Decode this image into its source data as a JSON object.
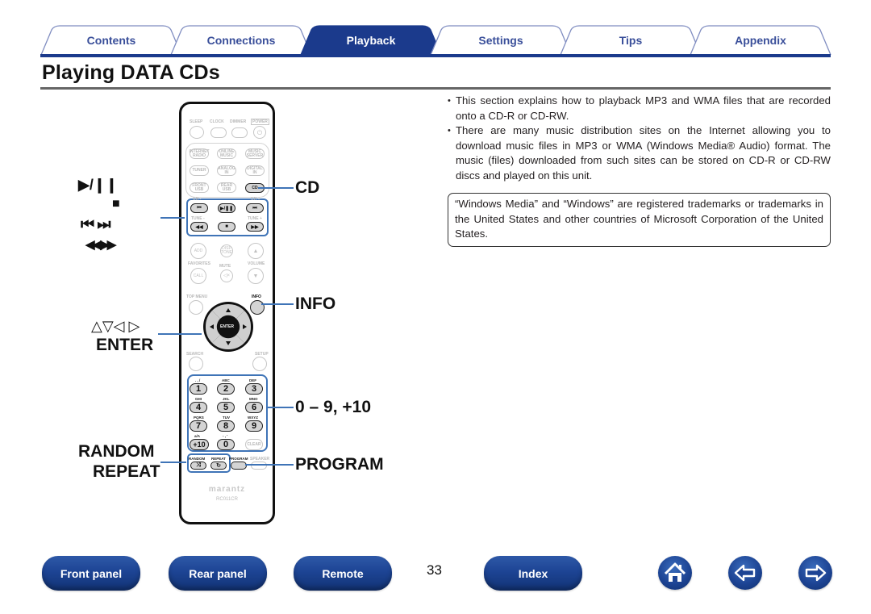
{
  "tabs": [
    {
      "label": "Contents",
      "active": false
    },
    {
      "label": "Connections",
      "active": false
    },
    {
      "label": "Playback",
      "active": true
    },
    {
      "label": "Settings",
      "active": false
    },
    {
      "label": "Tips",
      "active": false
    },
    {
      "label": "Appendix",
      "active": false
    }
  ],
  "page": {
    "title": "Playing DATA CDs",
    "number": "33"
  },
  "colors": {
    "brand_blue": "#1b3a8c",
    "highlight_blue": "#3f74b7",
    "tab_text": "#3a4f9a"
  },
  "callouts": {
    "left": {
      "transport_symbols": [
        "▶/❙❙",
        "■",
        "⏮ ⏭",
        "◀◀ ▶▶"
      ],
      "cursor_symbols": "△▽◁ ▷",
      "enter": "ENTER",
      "random": "RANDOM",
      "repeat": "REPEAT"
    },
    "right": {
      "cd": "CD",
      "info": "INFO",
      "numbers": "0 – 9, +10",
      "program": "PROGRAM"
    }
  },
  "remote": {
    "row1_labels": [
      "SLEEP",
      "CLOCK",
      "DIMMER",
      "POWER"
    ],
    "source_buttons": [
      "INTERNET RADIO",
      "ONLINE MUSIC",
      "MUSIC SERVER",
      "TUNER",
      "ANALOG IN",
      "DIGITAL IN",
      "FRONT USB",
      "REAR USB",
      "CD"
    ],
    "transport_labels": [
      "CH -",
      "CH +",
      "TUNE -",
      "TUNE +"
    ],
    "add": "ADD",
    "disp_tone": "DISP TONE",
    "favorites": "FAVORITES",
    "call": "CALL",
    "mute": "MUTE",
    "volume": "VOLUME",
    "top_menu": "TOP MENU",
    "info": "INFO",
    "enter": "ENTER",
    "search": "SEARCH",
    "setup": "SETUP",
    "keypad": [
      {
        "key": "1",
        "sub": ". , /"
      },
      {
        "key": "2",
        "sub": "ABC"
      },
      {
        "key": "3",
        "sub": "DEF"
      },
      {
        "key": "4",
        "sub": "GHI"
      },
      {
        "key": "5",
        "sub": "JKL"
      },
      {
        "key": "6",
        "sub": "MNO"
      },
      {
        "key": "7",
        "sub": "PQRS"
      },
      {
        "key": "8",
        "sub": "TUV"
      },
      {
        "key": "9",
        "sub": "WXYZ"
      },
      {
        "key": "+10",
        "sub": "a/A"
      },
      {
        "key": "0",
        "sub": "- , '"
      },
      {
        "key": "CLEAR",
        "sub": ""
      }
    ],
    "random_label": "RANDOM",
    "repeat_label": "REPEAT",
    "program_label": "PROGRAM",
    "speaker_label": "SPEAKER",
    "brand": "marantz",
    "model": "RC011CR"
  },
  "content": {
    "bullets": [
      "This section explains how to playback MP3 and WMA files that are recorded onto a CD-R or CD-RW.",
      "There are many music distribution sites on the Internet allowing you to download music files in MP3 or WMA (Windows Media® Audio) format. The music (files) downloaded from such sites can be stored on CD-R or CD-RW discs and played on this unit."
    ],
    "note": "“Windows Media” and “Windows” are registered trademarks or trademarks in the United States and other countries of Microsoft Corporation of the United States."
  },
  "footer": {
    "buttons": [
      "Front panel",
      "Rear panel",
      "Remote",
      "Index"
    ],
    "icons": [
      "home-icon",
      "back-arrow-icon",
      "forward-arrow-icon"
    ]
  }
}
